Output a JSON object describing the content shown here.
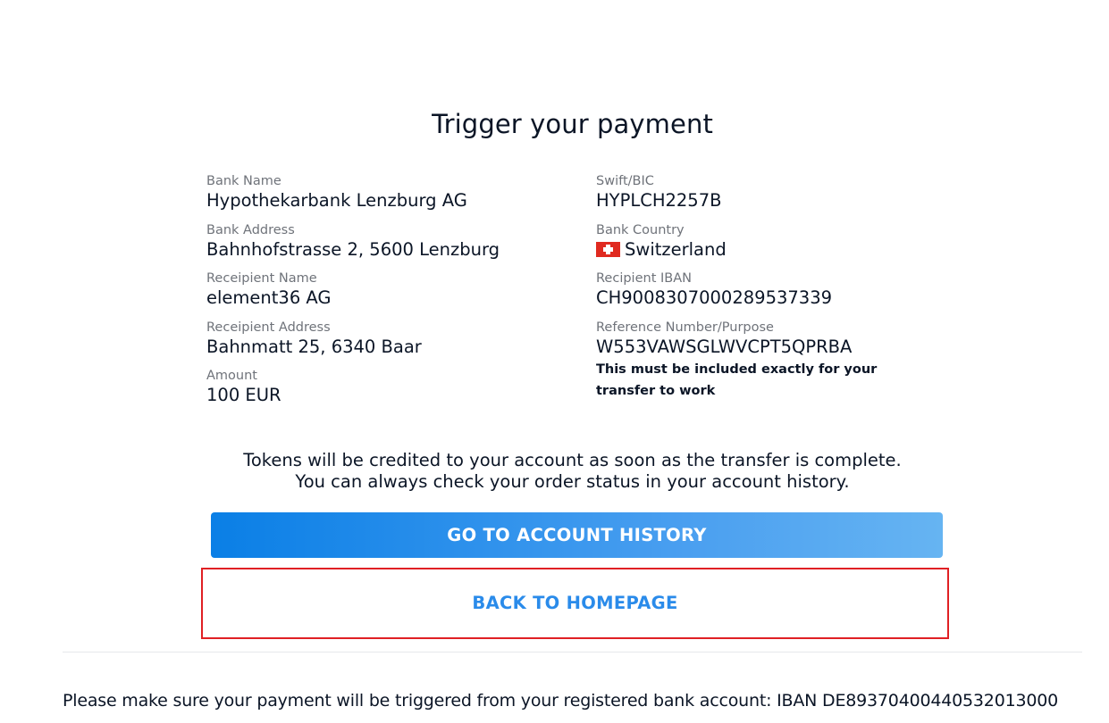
{
  "title": "Trigger your payment",
  "left_fields": [
    {
      "label": "Bank Name",
      "value": "Hypothekarbank Lenzburg AG"
    },
    {
      "label": "Bank Address",
      "value": "Bahnhofstrasse 2, 5600 Lenzburg"
    },
    {
      "label": "Receipient Name",
      "value": "element36 AG"
    },
    {
      "label": "Receipient Address",
      "value": "Bahnmatt 25, 6340 Baar"
    },
    {
      "label": "Amount",
      "value": "100 EUR"
    }
  ],
  "right_fields": [
    {
      "label": "Swift/BIC",
      "value": "HYPLCH2257B"
    },
    {
      "label": "Bank Country",
      "value": "Switzerland",
      "flag_icon": "swiss-flag-icon"
    },
    {
      "label": "Recipient IBAN",
      "value": "CH9008307000289537339"
    },
    {
      "label": "Reference Number/Purpose",
      "value": "W553VAWSGLWVCPT5QPRBA"
    }
  ],
  "reference_note": "This must be included exactly for your transfer to work",
  "info_line1": "Tokens will be credited to your account as soon as the transfer is complete.",
  "info_line2": "You can always check your order status in your account history.",
  "buttons": {
    "account_history": "GO TO ACCOUNT HISTORY",
    "homepage": "BACK TO HOMEPAGE"
  },
  "footer_text": "Please make sure your payment will be triggered from your registered bank account: IBAN DE89370400440532013000",
  "colors": {
    "primary_gradient_start": "#0a7fe6",
    "primary_gradient_end": "#66b4f2",
    "link_blue": "#2a8bea",
    "highlight_border": "#e02024"
  }
}
